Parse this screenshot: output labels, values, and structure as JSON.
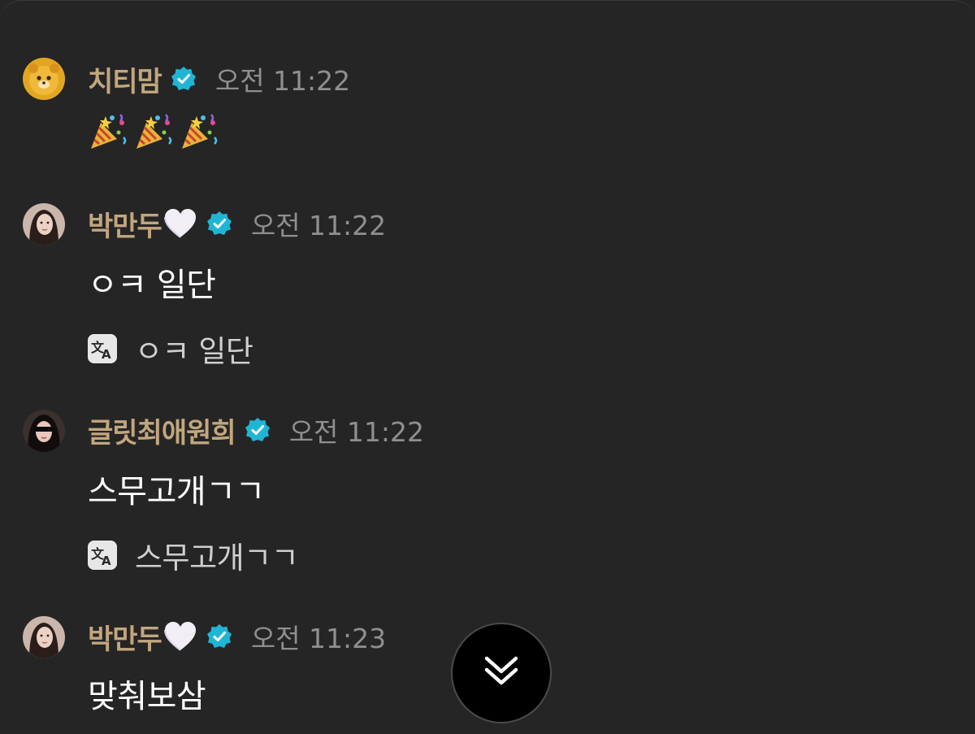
{
  "colors": {
    "background": "#252525",
    "name": "#c2a67e",
    "time": "#8f8f8f",
    "message": "#ffffff",
    "translation": "#cfcfcf",
    "verified_badge": "#1fb6d6"
  },
  "messages": [
    {
      "name": "치티맘",
      "verified": true,
      "heart": false,
      "time": "오전 11:22",
      "emoji": [
        "party-popper-icon",
        "party-popper-icon",
        "party-popper-icon"
      ],
      "text": "",
      "translation": ""
    },
    {
      "name": "박만두",
      "verified": true,
      "heart": true,
      "time": "오전 11:22",
      "text": "ㅇㅋ 일단",
      "translation": "ㅇㅋ 일단"
    },
    {
      "name": "글릿최애원희",
      "verified": true,
      "heart": false,
      "time": "오전 11:22",
      "text": "스무고개ㄱㄱ",
      "translation": "스무고개ㄱㄱ"
    },
    {
      "name": "박만두",
      "verified": true,
      "heart": true,
      "time": "오전 11:23",
      "text": "맞춰보삼",
      "translation": ""
    }
  ],
  "scroll_button": {
    "icon": "double-chevron-down-icon"
  }
}
